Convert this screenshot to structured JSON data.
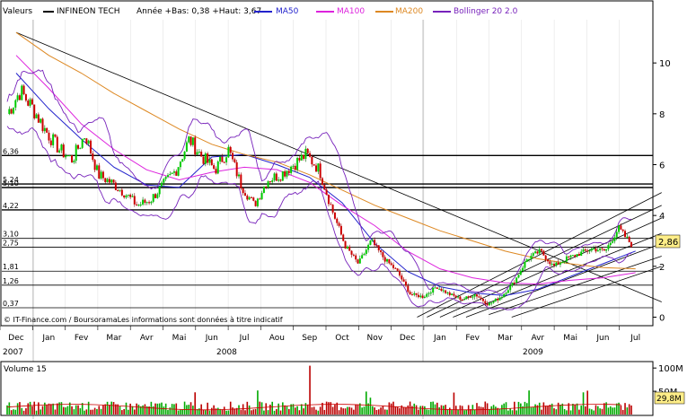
{
  "legend": {
    "valeurs": "Valeurs",
    "name": "INFINEON TECH",
    "range": "Année +Bas: 0,38 +Haut: 3,67",
    "ma50": "MA50",
    "ma100": "MA100",
    "ma200": "MA200",
    "bollinger": "Bollinger 20 2.0"
  },
  "footer_note": "© IT-Finance.com / BoursoramaLes informations sont données à titre indicatif",
  "last_price_label": "2,86",
  "volume": {
    "title": "Volume 15",
    "ticks": [
      "100M",
      "50M"
    ],
    "last_label": "29,8M"
  },
  "colors": {
    "price_up": "#00cc00",
    "price_down": "#cc0000",
    "ma50": "#2222cc",
    "ma100": "#dd22dd",
    "ma200": "#dd8822",
    "bollinger": "#7722bb",
    "accent_box": "#ffee88"
  },
  "chart_data": {
    "type": "line",
    "title": "INFINEON TECH",
    "x_months": [
      "Dec",
      "Jan",
      "Fev",
      "Mar",
      "Avr",
      "Mai",
      "Jun",
      "Jul",
      "Aou",
      "Sep",
      "Oct",
      "Nov",
      "Dec",
      "Jan",
      "Fev",
      "Mar",
      "Avr",
      "Mai",
      "Jun",
      "Jul"
    ],
    "x_years": [
      "2007",
      "2008",
      "2009"
    ],
    "y_ticks": [
      0,
      2,
      4,
      6,
      8,
      10
    ],
    "ylim": [
      -0.3,
      11.7
    ],
    "level_labels": [
      "6,36",
      "5,24",
      "5,10",
      "4,22",
      "3,10",
      "2,75",
      "1,81",
      "1,26",
      "0,37"
    ],
    "series": [
      {
        "name": "INFINEON TECH",
        "values": [
          8.0,
          8.9,
          8.2,
          7.3,
          6.6,
          6.2,
          7.2,
          5.6,
          5.3,
          4.9,
          4.4,
          4.6,
          5.2,
          5.8,
          7.0,
          6.3,
          5.8,
          6.6,
          5.2,
          4.4,
          5.4,
          5.6,
          6.0,
          6.4,
          5.8,
          4.2,
          2.8,
          2.1,
          3.0,
          2.3,
          1.8,
          0.9,
          0.8,
          1.2,
          0.9,
          0.7,
          0.9,
          0.5,
          0.8,
          1.4,
          2.3,
          2.6,
          2.0,
          2.3,
          2.5,
          2.7,
          2.6,
          3.5,
          2.86
        ]
      },
      {
        "name": "MA50",
        "values": [
          9.6,
          8.2,
          7.0,
          5.9,
          5.2,
          5.1,
          6.3,
          6.4,
          6.0,
          5.5,
          4.5,
          2.9,
          1.8,
          1.2,
          0.95,
          0.85,
          1.1,
          1.6,
          2.1,
          2.6
        ]
      },
      {
        "name": "MA100",
        "values": [
          10.3,
          9.0,
          7.6,
          6.6,
          5.8,
          5.4,
          5.7,
          5.9,
          5.8,
          5.3,
          4.4,
          3.6,
          2.6,
          1.9,
          1.55,
          1.35,
          1.3,
          1.45,
          1.55,
          1.75
        ]
      },
      {
        "name": "MA200",
        "values": [
          11.2,
          10.3,
          9.6,
          8.8,
          8.1,
          7.4,
          6.8,
          6.4,
          6.1,
          5.6,
          5.0,
          4.4,
          3.9,
          3.4,
          3.0,
          2.6,
          2.3,
          2.1,
          1.95,
          1.9
        ]
      }
    ]
  }
}
